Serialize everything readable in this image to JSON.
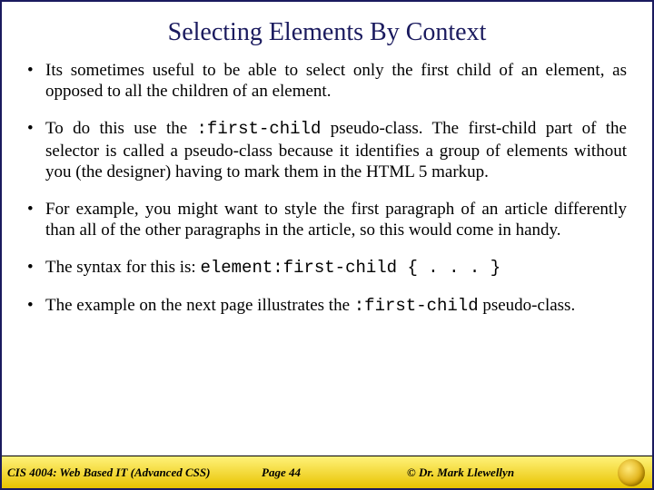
{
  "title": "Selecting Elements By Context",
  "bullets": [
    {
      "text": "Its sometimes useful to be able to select only the first child of an element, as opposed to all the children of an element."
    },
    {
      "pre": "To do this use the ",
      "code": ":first-child",
      "post": " pseudo-class.  The first-child part of the selector is called a pseudo-class because it identifies a group of elements without you (the designer) having to mark them in the HTML 5 markup."
    },
    {
      "text": "For example, you might want to style the first paragraph of an article differently than all of the other paragraphs in the article, so this would come in handy."
    },
    {
      "pre": "The syntax for this is:  ",
      "code": "element:first-child { . . . }"
    },
    {
      "pre": "The example on the next page illustrates the ",
      "code": ":first-child",
      "post": " pseudo-class."
    }
  ],
  "footer": {
    "course": "CIS 4004: Web Based IT (Advanced CSS)",
    "page": "Page 44",
    "author": "© Dr. Mark Llewellyn"
  }
}
